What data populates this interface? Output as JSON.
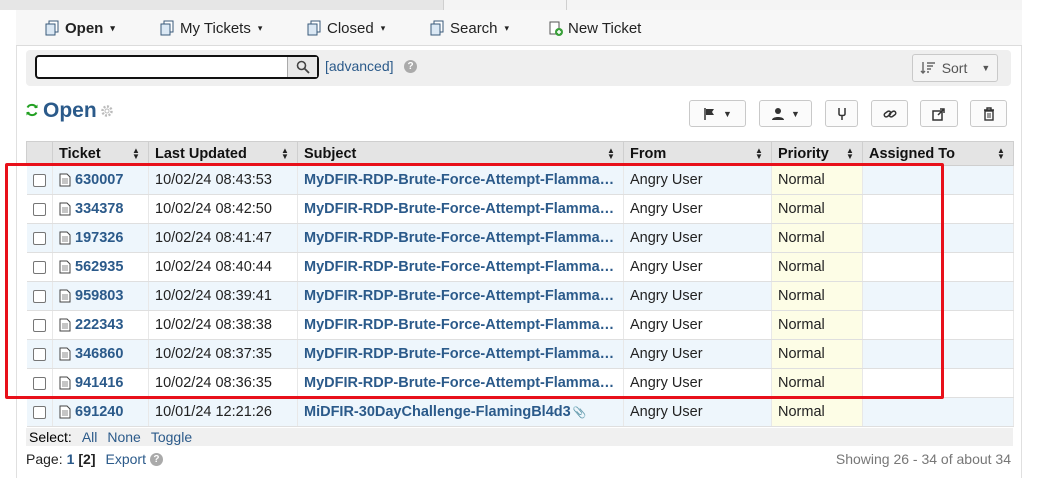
{
  "nav": {
    "items": [
      {
        "label": "Open",
        "caret": "▾",
        "icon": "tickets-icon"
      },
      {
        "label": "My Tickets",
        "caret": "▾",
        "icon": "tickets-icon"
      },
      {
        "label": "Closed",
        "caret": "▾",
        "icon": "tickets-icon"
      },
      {
        "label": "Search",
        "caret": "▾",
        "icon": "tickets-icon"
      },
      {
        "label": "New Ticket",
        "caret": "",
        "icon": "new-ticket-icon"
      }
    ]
  },
  "search": {
    "value": "",
    "advanced_label": "[advanced]",
    "sort_label": "Sort"
  },
  "title": "Open",
  "table": {
    "headers": [
      "Ticket",
      "Last Updated",
      "Subject",
      "From",
      "Priority",
      "Assigned To"
    ],
    "rows": [
      {
        "ticket": "630007",
        "updated": "10/02/24 08:43:53",
        "subject": "MyDFIR-RDP-Brute-Force-Attempt-Flammable-Matters",
        "from": "Angry User",
        "priority": "Normal",
        "assigned": ""
      },
      {
        "ticket": "334378",
        "updated": "10/02/24 08:42:50",
        "subject": "MyDFIR-RDP-Brute-Force-Attempt-Flammable-Matters",
        "from": "Angry User",
        "priority": "Normal",
        "assigned": ""
      },
      {
        "ticket": "197326",
        "updated": "10/02/24 08:41:47",
        "subject": "MyDFIR-RDP-Brute-Force-Attempt-Flammable-Matters",
        "from": "Angry User",
        "priority": "Normal",
        "assigned": ""
      },
      {
        "ticket": "562935",
        "updated": "10/02/24 08:40:44",
        "subject": "MyDFIR-RDP-Brute-Force-Attempt-Flammable-Matters",
        "from": "Angry User",
        "priority": "Normal",
        "assigned": ""
      },
      {
        "ticket": "959803",
        "updated": "10/02/24 08:39:41",
        "subject": "MyDFIR-RDP-Brute-Force-Attempt-Flammable-Matters",
        "from": "Angry User",
        "priority": "Normal",
        "assigned": ""
      },
      {
        "ticket": "222343",
        "updated": "10/02/24 08:38:38",
        "subject": "MyDFIR-RDP-Brute-Force-Attempt-Flammable-Matters",
        "from": "Angry User",
        "priority": "Normal",
        "assigned": ""
      },
      {
        "ticket": "346860",
        "updated": "10/02/24 08:37:35",
        "subject": "MyDFIR-RDP-Brute-Force-Attempt-Flammable-Matters",
        "from": "Angry User",
        "priority": "Normal",
        "assigned": ""
      },
      {
        "ticket": "941416",
        "updated": "10/02/24 08:36:35",
        "subject": "MyDFIR-RDP-Brute-Force-Attempt-Flammable-Matters",
        "from": "Angry User",
        "priority": "Normal",
        "assigned": ""
      },
      {
        "ticket": "691240",
        "updated": "10/01/24 12:21:26",
        "subject": "MiDFIR-30DayChallenge-FlamingBl4d3",
        "from": "Angry User",
        "priority": "Normal",
        "assigned": ""
      }
    ]
  },
  "footer": {
    "select_label": "Select:",
    "select_all": "All",
    "select_none": "None",
    "select_toggle": "Toggle",
    "page_label": "Page:",
    "page_current": "1",
    "page_other": "[2]",
    "export_label": "Export",
    "showing": "Showing 26 - 34 of about 34"
  },
  "colors": {
    "link": "#2b5a8a",
    "highlight": "#e8101a",
    "refresh": "#22a022"
  }
}
